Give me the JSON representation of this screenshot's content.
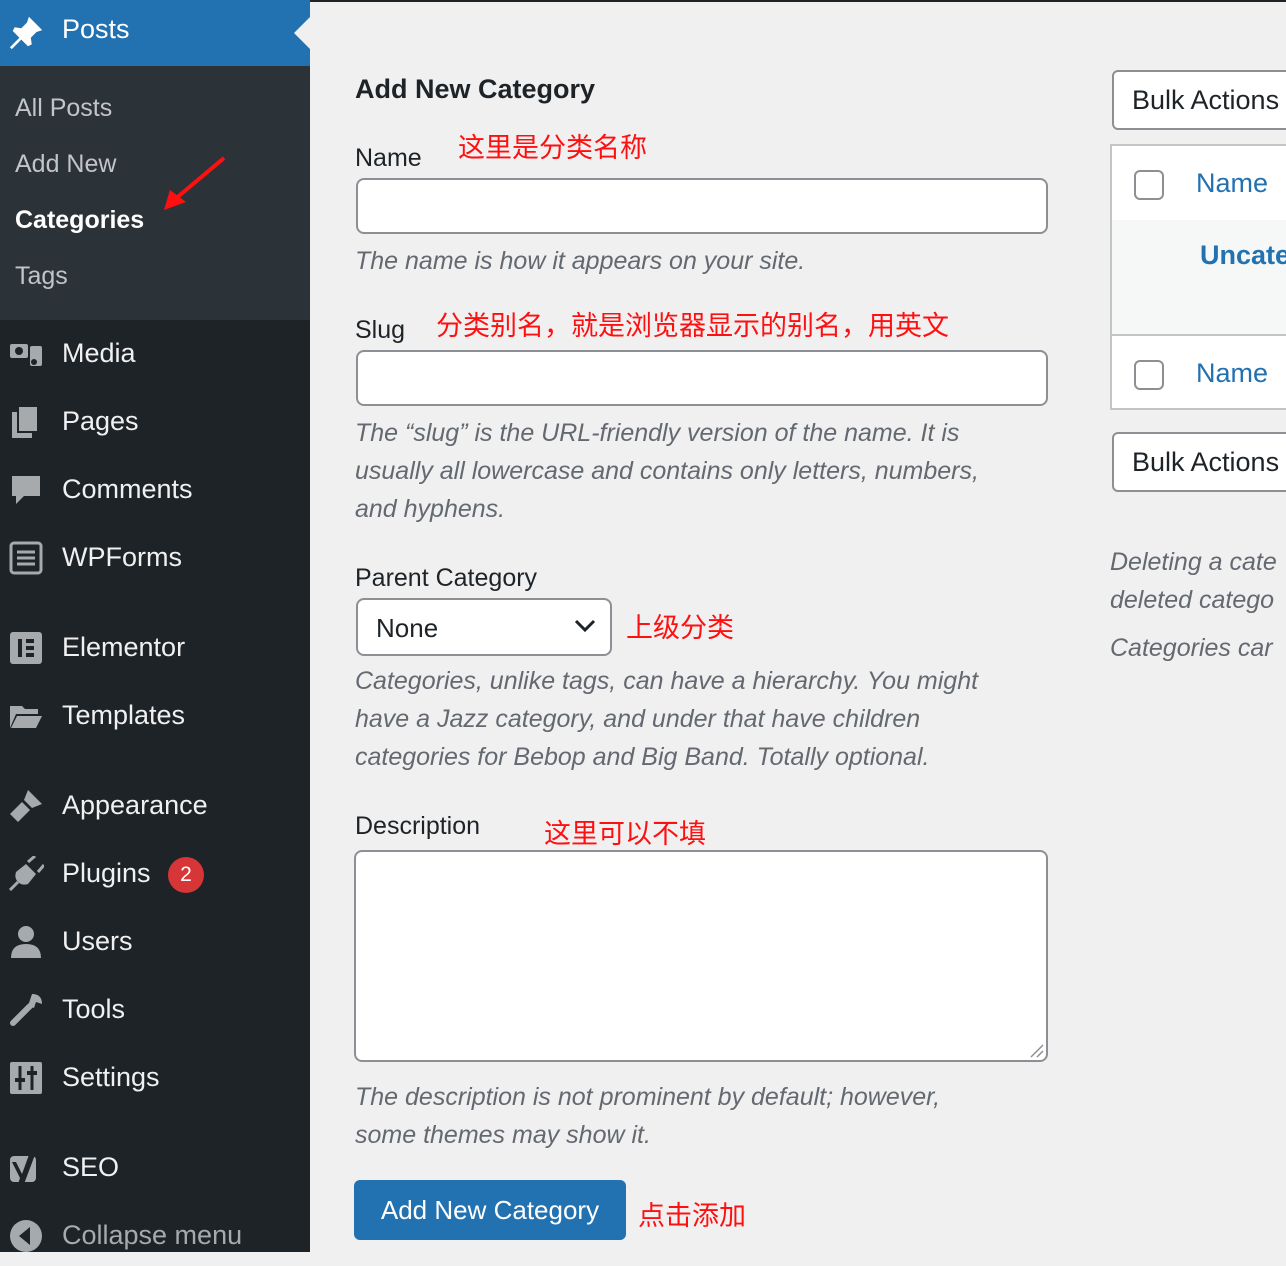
{
  "sidebar": {
    "posts_label": "Posts",
    "submenu": [
      "All Posts",
      "Add New",
      "Categories",
      "Tags"
    ],
    "menu": [
      {
        "label": "Media",
        "icon": "media-icon"
      },
      {
        "label": "Pages",
        "icon": "pages-icon"
      },
      {
        "label": "Comments",
        "icon": "comments-icon"
      },
      {
        "label": "WPForms",
        "icon": "wpforms-icon"
      },
      {
        "label": "Elementor",
        "icon": "elementor-icon"
      },
      {
        "label": "Templates",
        "icon": "templates-icon"
      },
      {
        "label": "Appearance",
        "icon": "appearance-icon"
      },
      {
        "label": "Plugins",
        "icon": "plugins-icon",
        "badge": "2"
      },
      {
        "label": "Users",
        "icon": "users-icon"
      },
      {
        "label": "Tools",
        "icon": "tools-icon"
      },
      {
        "label": "Settings",
        "icon": "settings-icon"
      },
      {
        "label": "SEO",
        "icon": "yoast-icon"
      },
      {
        "label": "Collapse menu",
        "icon": "collapse-icon"
      }
    ]
  },
  "form": {
    "title": "Add New Category",
    "name_label": "Name",
    "name_note": "这里是分类名称",
    "name_value": "",
    "name_help": "The name is how it appears on your site.",
    "slug_label": "Slug",
    "slug_note": "分类别名，就是浏览器显示的别名，用英文",
    "slug_value": "",
    "slug_help_1": "The “slug” is the URL-friendly version of the name. It is",
    "slug_help_2": "usually all lowercase and contains only letters, numbers,",
    "slug_help_3": "and hyphens.",
    "parent_label": "Parent Category",
    "parent_value": "None",
    "parent_note": "上级分类",
    "parent_help_1": "Categories, unlike tags, can have a hierarchy. You might",
    "parent_help_2": "have a Jazz category, and under that have children",
    "parent_help_3": "categories for Bebop and Big Band. Totally optional.",
    "desc_label": "Description",
    "desc_note": "这里可以不填",
    "desc_value": "",
    "desc_help_1": "The description is not prominent by default; however,",
    "desc_help_2": "some themes may show it.",
    "submit_label": "Add New Category",
    "submit_note": "点击添加"
  },
  "list": {
    "bulk_label": "Bulk Actions",
    "col_name": "Name",
    "row_name": "Uncate",
    "note_1": "Deleting a cate",
    "note_2": "deleted catego",
    "note_3": "Categories car"
  },
  "colors": {
    "accent": "#2271b1",
    "sidebar": "#1d2327",
    "annotation": "#ff1010",
    "badge": "#d63638"
  }
}
